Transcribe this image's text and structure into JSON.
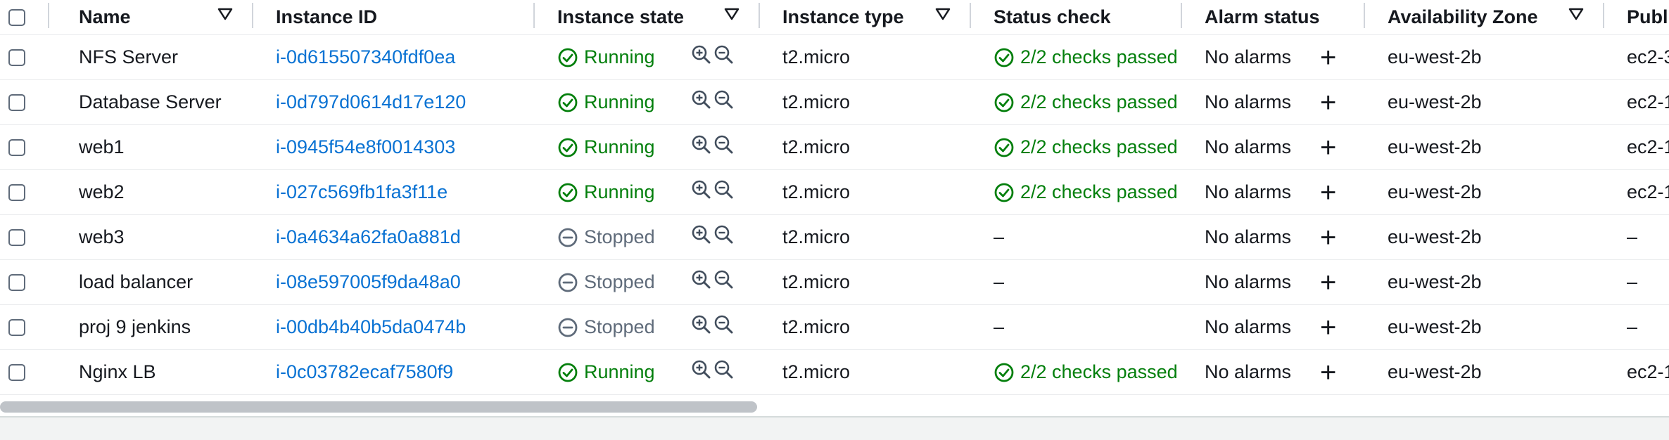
{
  "columns": {
    "name": "Name",
    "instance_id": "Instance ID",
    "instance_state": "Instance state",
    "instance_type": "Instance type",
    "status_check": "Status check",
    "alarm_status": "Alarm status",
    "availability_zone": "Availability Zone",
    "public": "Publ"
  },
  "rows": [
    {
      "name": "NFS Server",
      "id": "i-0d615507340fdf0ea",
      "state": "Running",
      "type": "t2.micro",
      "status": "2/2 checks passed",
      "alarm": "No alarms",
      "az": "eu-west-2b",
      "public": "ec2-3"
    },
    {
      "name": "Database Server",
      "id": "i-0d797d0614d17e120",
      "state": "Running",
      "type": "t2.micro",
      "status": "2/2 checks passed",
      "alarm": "No alarms",
      "az": "eu-west-2b",
      "public": "ec2-1"
    },
    {
      "name": "web1",
      "id": "i-0945f54e8f0014303",
      "state": "Running",
      "type": "t2.micro",
      "status": "2/2 checks passed",
      "alarm": "No alarms",
      "az": "eu-west-2b",
      "public": "ec2-1"
    },
    {
      "name": "web2",
      "id": "i-027c569fb1fa3f11e",
      "state": "Running",
      "type": "t2.micro",
      "status": "2/2 checks passed",
      "alarm": "No alarms",
      "az": "eu-west-2b",
      "public": "ec2-1"
    },
    {
      "name": "web3",
      "id": "i-0a4634a62fa0a881d",
      "state": "Stopped",
      "type": "t2.micro",
      "status": "–",
      "alarm": "No alarms",
      "az": "eu-west-2b",
      "public": "–"
    },
    {
      "name": "load balancer",
      "id": "i-08e597005f9da48a0",
      "state": "Stopped",
      "type": "t2.micro",
      "status": "–",
      "alarm": "No alarms",
      "az": "eu-west-2b",
      "public": "–"
    },
    {
      "name": "proj 9 jenkins",
      "id": "i-00db4b40b5da0474b",
      "state": "Stopped",
      "type": "t2.micro",
      "status": "–",
      "alarm": "No alarms",
      "az": "eu-west-2b",
      "public": "–"
    },
    {
      "name": "Nginx LB",
      "id": "i-0c03782ecaf7580f9",
      "state": "Running",
      "type": "t2.micro",
      "status": "2/2 checks passed",
      "alarm": "No alarms",
      "az": "eu-west-2b",
      "public": "ec2-1"
    }
  ],
  "colors": {
    "running": "#037f0c",
    "stopped": "#5f6b7a",
    "link": "#0972d3"
  }
}
